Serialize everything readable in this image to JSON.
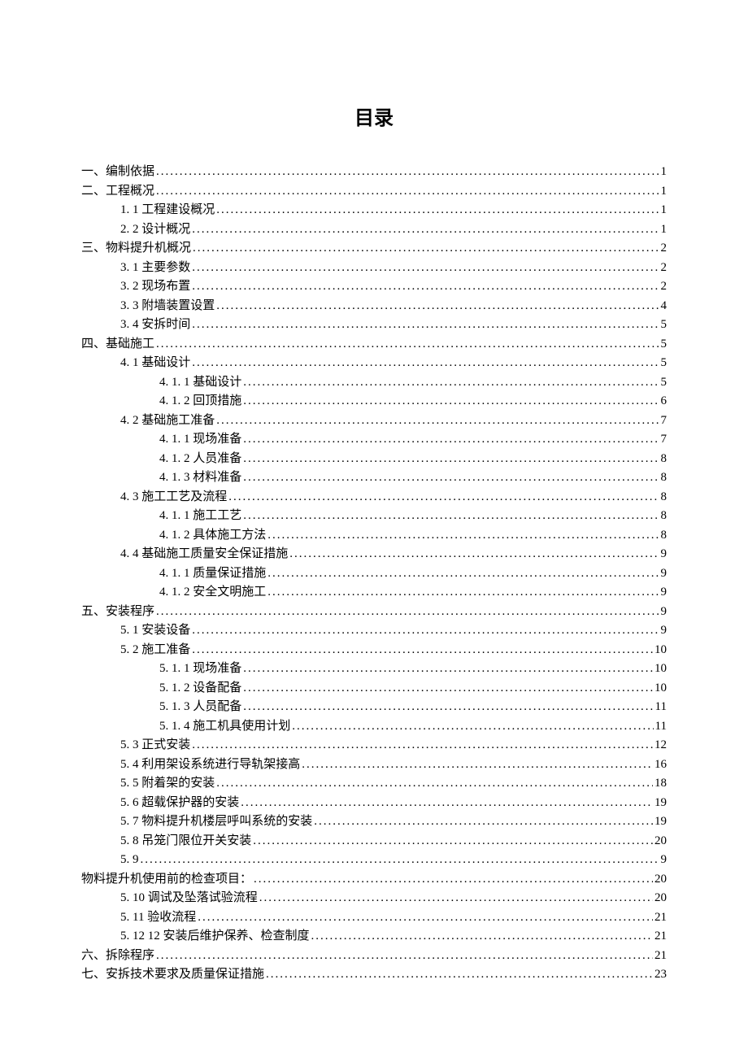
{
  "title": "目录",
  "entries": [
    {
      "level": 1,
      "label": "一、编制依据",
      "page": "1"
    },
    {
      "level": 1,
      "label": "二、工程概况",
      "page": "1"
    },
    {
      "level": 2,
      "label": "1. 1  工程建设概况",
      "page": "1"
    },
    {
      "level": 2,
      "label": "2.  2 设计概况",
      "page": "1"
    },
    {
      "level": 1,
      "label": "三、物料提升机概况",
      "page": "2"
    },
    {
      "level": 2,
      "label": "3. 1 主要参数",
      "page": "2"
    },
    {
      "level": 2,
      "label": "3.  2 现场布置",
      "page": "2"
    },
    {
      "level": 2,
      "label": "3.  3 附墙装置设置",
      "page": "4"
    },
    {
      "level": 2,
      "label": "3.  4 安拆时间",
      "page": "5"
    },
    {
      "level": 1,
      "label": "四、基础施工",
      "page": "5"
    },
    {
      "level": 2,
      "label": "4. 1 基础设计",
      "page": "5"
    },
    {
      "level": 3,
      "label": "4. 1. 1 基础设计",
      "page": "5"
    },
    {
      "level": 3,
      "label": "4. 1. 2 回顶措施",
      "page": "6"
    },
    {
      "level": 2,
      "label": "4.  2 基础施工准备",
      "page": "7"
    },
    {
      "level": 3,
      "label": "4. 1. 1 现场准备",
      "page": "7"
    },
    {
      "level": 3,
      "label": "4. 1. 2 人员准备",
      "page": "8"
    },
    {
      "level": 3,
      "label": "4. 1. 3 材料准备",
      "page": "8"
    },
    {
      "level": 2,
      "label": "4.  3 施工工艺及流程",
      "page": "8"
    },
    {
      "level": 3,
      "label": "4. 1. 1 施工工艺",
      "page": "8"
    },
    {
      "level": 3,
      "label": "4. 1. 2 具体施工方法",
      "page": "8"
    },
    {
      "level": 2,
      "label": "4.  4 基础施工质量安全保证措施",
      "page": "9"
    },
    {
      "level": 3,
      "label": "4. 1. 1 质量保证措施",
      "page": "9"
    },
    {
      "level": 3,
      "label": "4. 1. 2 安全文明施工",
      "page": "9"
    },
    {
      "level": 1,
      "label": "五、安装程序",
      "page": "9"
    },
    {
      "level": 2,
      "label": "5.  1 安装设备",
      "page": "9"
    },
    {
      "level": 2,
      "label": "5.  2 施工准备",
      "page": "10"
    },
    {
      "level": 3,
      "label": "5. 1. 1 现场准备",
      "page": "10"
    },
    {
      "level": 3,
      "label": "5. 1. 2 设备配备",
      "page": "10"
    },
    {
      "level": 3,
      "label": "5. 1. 3 人员配备",
      "page": "11"
    },
    {
      "level": 3,
      "label": "5. 1. 4 施工机具使用计划",
      "page": "11"
    },
    {
      "level": 2,
      "label": "5. 3 正式安装",
      "page": "12"
    },
    {
      "level": 2,
      "label": "5. 4 利用架设系统进行导轨架接高",
      "page": "16"
    },
    {
      "level": 2,
      "label": "5. 5 附着架的安装",
      "page": "18"
    },
    {
      "level": 2,
      "label": "5. 6 超载保护器的安装",
      "page": "19"
    },
    {
      "level": 2,
      "label": "5. 7  物料提升机楼层呼叫系统的安装",
      "page": "19"
    },
    {
      "level": 2,
      "label": "5. 8  吊笼门限位开关安装",
      "page": "20"
    },
    {
      "level": 2,
      "label": "5. 9",
      "page": "9"
    },
    {
      "level": 1,
      "label": "物料提升机使用前的检查项目：",
      "page": "20"
    },
    {
      "level": 2,
      "label": "5. 10   调试及坠落试验流程",
      "page": "20"
    },
    {
      "level": 2,
      "label": "5. 11   验收流程",
      "page": "21"
    },
    {
      "level": 2,
      "label": "5. 12 12 安装后维护保养、检查制度",
      "page": "21"
    },
    {
      "level": 1,
      "label": "六、拆除程序",
      "page": "21"
    },
    {
      "level": 1,
      "label": "七、安拆技术要求及质量保证措施",
      "page": "23"
    }
  ]
}
